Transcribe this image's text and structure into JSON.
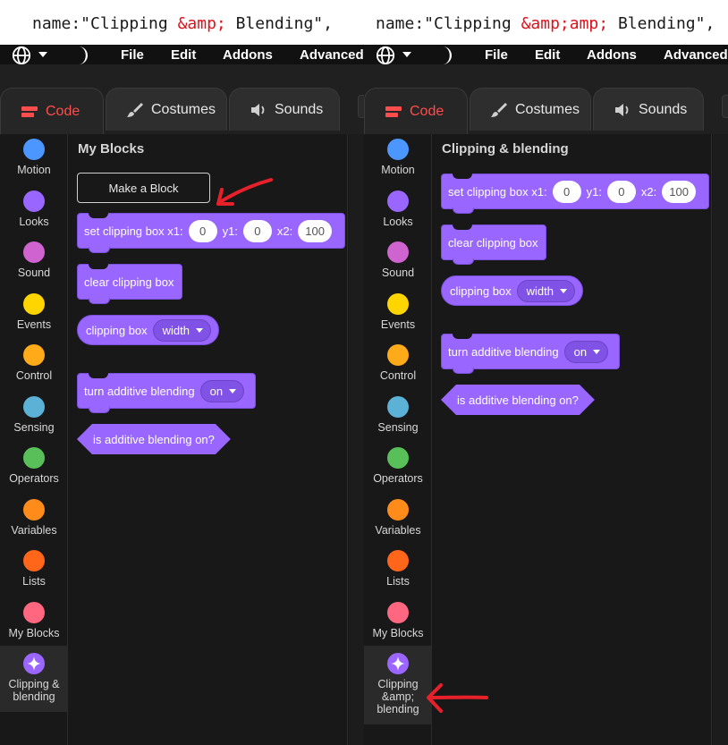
{
  "code_strip": {
    "left": {
      "prefix": "name:\"Clipping ",
      "amp": "&amp;",
      "suffix": " Blending\","
    },
    "right": {
      "prefix": "name:\"Clipping ",
      "amp": "&amp;amp;",
      "suffix": " Blending\","
    }
  },
  "menu": {
    "file": "File",
    "edit": "Edit",
    "addons": "Addons",
    "advanced": "Advanced"
  },
  "tabs": {
    "code": "Code",
    "costumes": "Costumes",
    "sounds": "Sounds"
  },
  "categories": [
    {
      "label": "Motion",
      "color": "#4c97ff"
    },
    {
      "label": "Looks",
      "color": "#9966ff"
    },
    {
      "label": "Sound",
      "color": "#cf63cf"
    },
    {
      "label": "Events",
      "color": "#ffd500"
    },
    {
      "label": "Control",
      "color": "#ffab19"
    },
    {
      "label": "Sensing",
      "color": "#5cb1d6"
    },
    {
      "label": "Operators",
      "color": "#59c059"
    },
    {
      "label": "Variables",
      "color": "#ff8c1a"
    },
    {
      "label": "Lists",
      "color": "#ff661a"
    },
    {
      "label": "My Blocks",
      "color": "#ff6680"
    }
  ],
  "left_pane": {
    "extension_label_1": "Clipping &",
    "extension_label_2": "blending",
    "palette_title": "My Blocks",
    "make_block": "Make a Block"
  },
  "right_pane": {
    "extension_label_1": "Clipping",
    "extension_label_2": "&amp;",
    "extension_label_3": "blending",
    "palette_title": "Clipping & blending"
  },
  "blocks": {
    "set_clipping": "set clipping box x1:",
    "x1": "0",
    "y1_label": "y1:",
    "y1": "0",
    "x2_label": "x2:",
    "x2": "100",
    "clear_clipping": "clear clipping box",
    "clipping_box": "clipping box",
    "clipping_box_option": "width",
    "turn_additive": "turn additive blending",
    "additive_option": "on",
    "is_additive": "is additive blending on?"
  },
  "colors": {
    "accent": "#ff4c4c",
    "extension": "#9966ff",
    "arrow": "#e8202a"
  }
}
